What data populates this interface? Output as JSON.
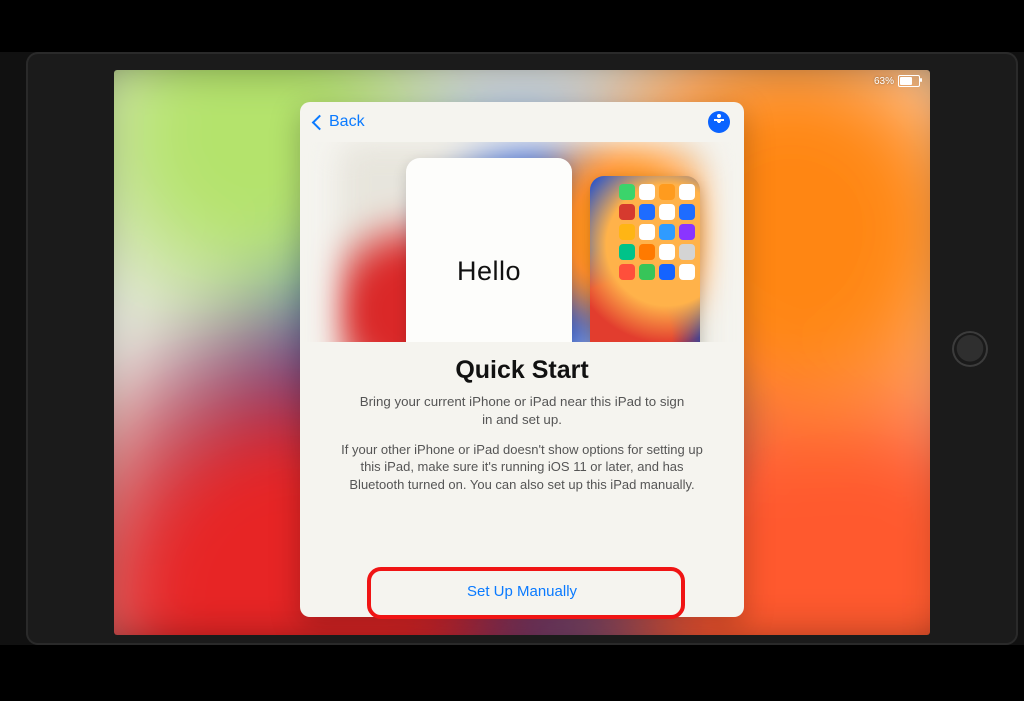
{
  "status": {
    "battery_pct": "63%"
  },
  "modal": {
    "back_label": "Back",
    "hello": "Hello",
    "title": "Quick Start",
    "paragraph1": "Bring your current iPhone or iPad near this iPad to sign in and set up.",
    "paragraph2": "If your other iPhone or iPad doesn't show options for setting up this iPad, make sure it's running iOS 11 or later, and has Bluetooth turned on. You can also set up this iPad manually.",
    "manual_label": "Set Up Manually"
  },
  "app_colors": [
    "#3bd46b",
    "#ffffff",
    "#ff9b1e",
    "#ffffff",
    "#d63a2e",
    "#1e6cff",
    "#ffffff",
    "#1e6cff",
    "#ffb514",
    "#ffffff",
    "#2f9bff",
    "#8a35ff",
    "#00c389",
    "#ff7a00",
    "#ffffff",
    "#d4d4d4",
    "#ff4f3b",
    "#37c559",
    "#1463ff",
    "#ffffff"
  ]
}
